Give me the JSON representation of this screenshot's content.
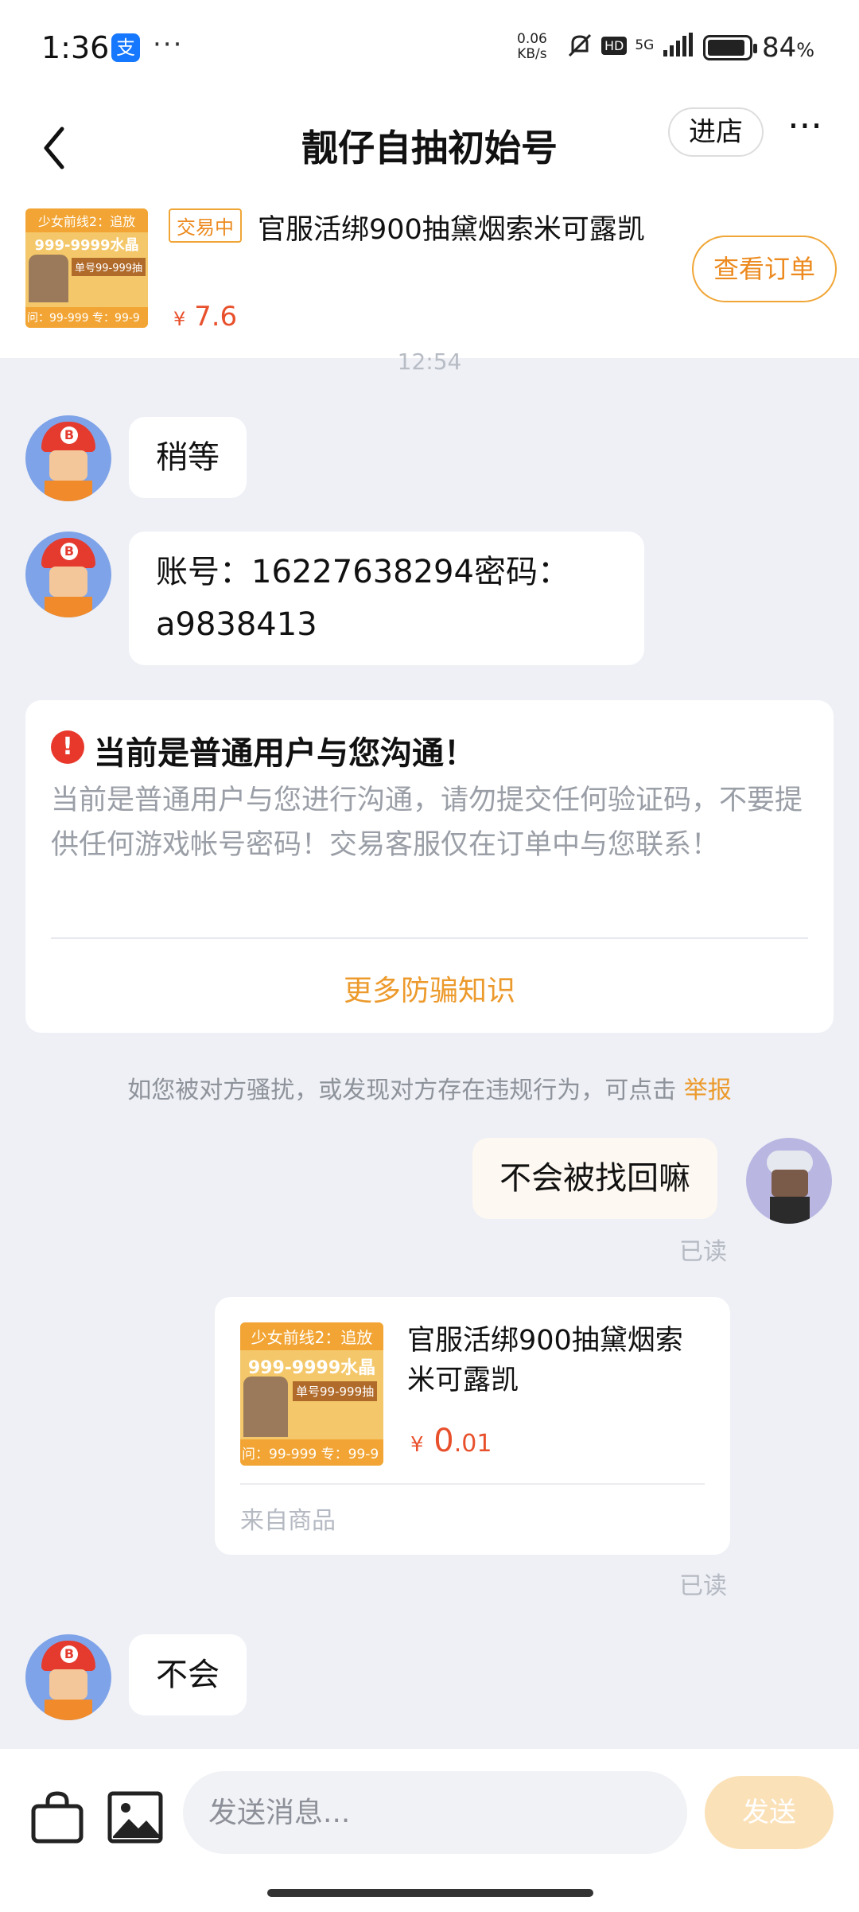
{
  "status_bar": {
    "time": "1:36",
    "app_badge": "支",
    "dots": "···",
    "net_speed_value": "0.06",
    "net_speed_unit": "KB/s",
    "hd": "HD",
    "network": "5G",
    "battery": "84",
    "battery_unit": "%"
  },
  "header": {
    "title": "靓仔自抽初始号",
    "store_button": "进店",
    "more": "···"
  },
  "product": {
    "thumb_line1": "少女前线2：追放",
    "thumb_line2": "999-9999水晶",
    "thumb_line3": "单号99-999抽",
    "thumb_line4": "问：99-999 专：99-9",
    "status": "交易中",
    "title": "官服活绑900抽黛烟索米可露凯",
    "currency": "¥",
    "price": "7.6",
    "order_button": "查看订单"
  },
  "chat": {
    "timestamp": "12:54",
    "msg1": "稍等",
    "msg2_line1": "账号：16227638294密码：",
    "msg2_line2": "a9838413",
    "notice": {
      "title": "当前是普通用户与您沟通！",
      "body": "当前是普通用户与您进行沟通，请勿提交任何验证码，不要提供任何游戏帐号密码！交易客服仅在订单中与您联系！",
      "link": "更多防骗知识"
    },
    "report_text": "如您被对方骚扰，或发现对方存在违规行为，可点击",
    "report_link": "举报",
    "my_msg": "不会被找回嘛",
    "read1": "已读",
    "card": {
      "title": "官服活绑900抽黛烟索米可露凯",
      "currency": "¥",
      "price_int": "0",
      "price_dec": ".01",
      "source": "来自商品"
    },
    "read2": "已读",
    "msg3": "不会"
  },
  "input": {
    "placeholder": "发送消息...",
    "send_button": "发送"
  },
  "colors": {
    "accent": "#ec9a2c",
    "price": "#e8502c",
    "background": "#eef0f5"
  }
}
